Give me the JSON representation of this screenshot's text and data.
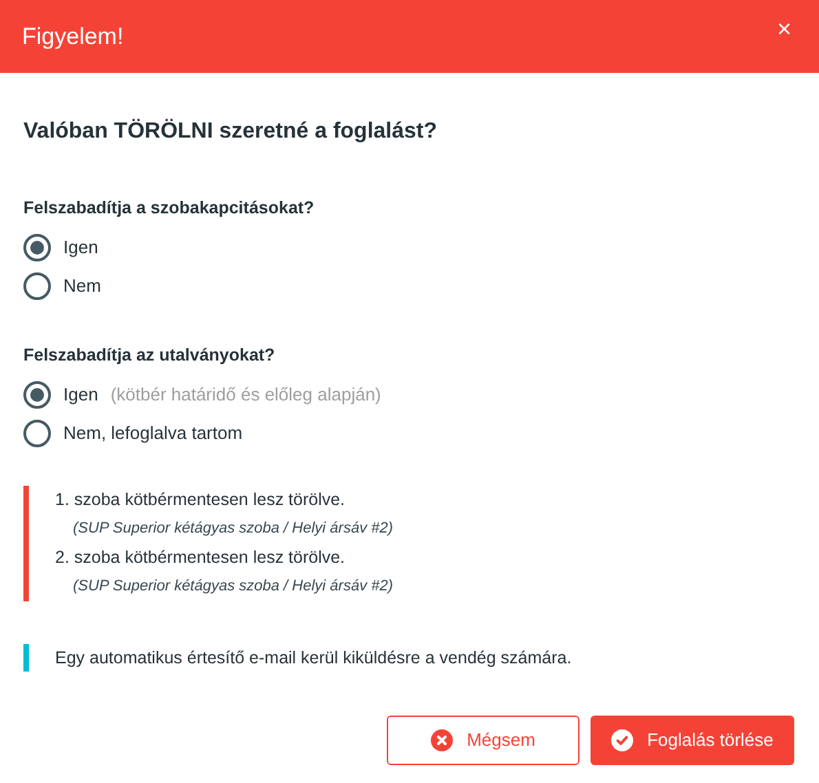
{
  "dialog": {
    "title": "Figyelem!",
    "close": "×"
  },
  "question": "Valóban TÖRÖLNI szeretné a foglalást?",
  "groups": [
    {
      "label": "Felszabadítja a szobakapcitásokat?",
      "options": [
        {
          "label": "Igen",
          "selected": true
        },
        {
          "label": "Nem",
          "selected": false
        }
      ]
    },
    {
      "label": "Felszabadítja az utalványokat?",
      "options": [
        {
          "label": "Igen",
          "hint": "(kötbér határidő és előleg alapján)",
          "selected": true
        },
        {
          "label": "Nem, lefoglalva tartom",
          "selected": false
        }
      ]
    }
  ],
  "notices": [
    {
      "color": "#f44336",
      "lines": [
        {
          "text": "1. szoba kötbérmentesen lesz törölve.",
          "detail": "(SUP Superior kétágyas szoba / Helyi ársáv #2)"
        },
        {
          "text": "2. szoba kötbérmentesen lesz törölve.",
          "detail": "(SUP Superior kétágyas szoba / Helyi ársáv #2)"
        }
      ]
    },
    {
      "color": "#00bcd4",
      "lines": [
        {
          "text": "Egy automatikus értesítő e-mail kerül kiküldésre a vendég számára."
        }
      ]
    }
  ],
  "buttons": [
    {
      "label": "Mégsem",
      "kind": "cancel"
    },
    {
      "label": "Foglalás törlése",
      "kind": "confirm"
    }
  ]
}
